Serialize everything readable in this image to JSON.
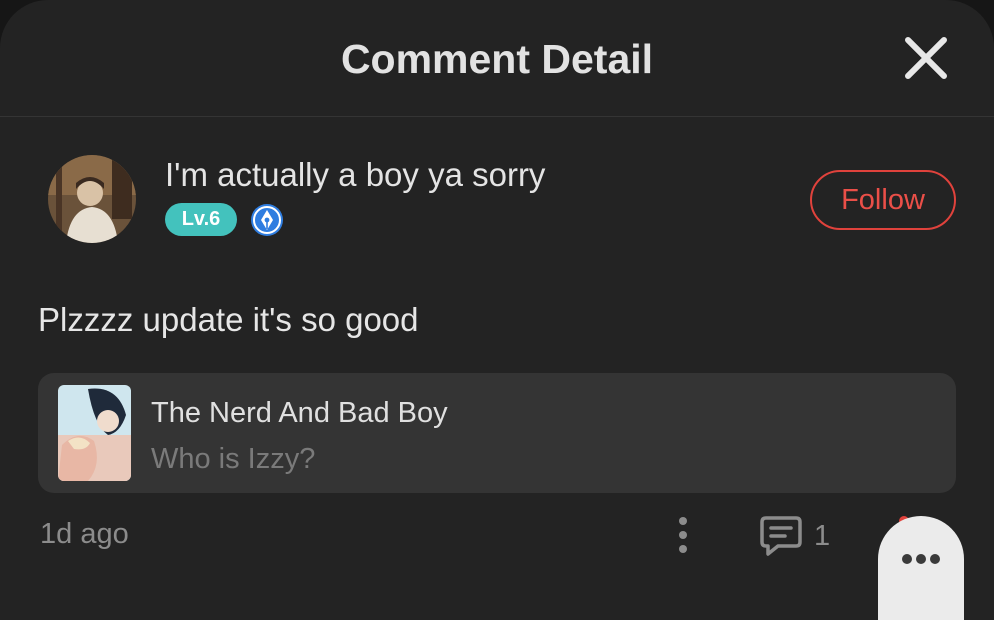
{
  "header": {
    "title": "Comment Detail",
    "close_icon": "close-icon"
  },
  "user": {
    "name": "I'm actually a boy ya sorry",
    "level": "Lv.6",
    "badge_icon": "pen-nib-icon",
    "follow_label": "Follow"
  },
  "comment": {
    "text": "Plzzzz update it's so good"
  },
  "series_card": {
    "title": "The Nerd And Bad Boy",
    "subtitle": "Who is Izzy?"
  },
  "footer": {
    "time": "1d ago",
    "reply_count": "1",
    "more_icon": "more-vertical-icon",
    "reply_icon": "comment-icon",
    "fab_icon": "more-horizontal-icon"
  },
  "colors": {
    "accent": "#e0423c",
    "level_badge": "#43c2bd",
    "writer_badge": "#2f7de0",
    "background": "#232323"
  }
}
